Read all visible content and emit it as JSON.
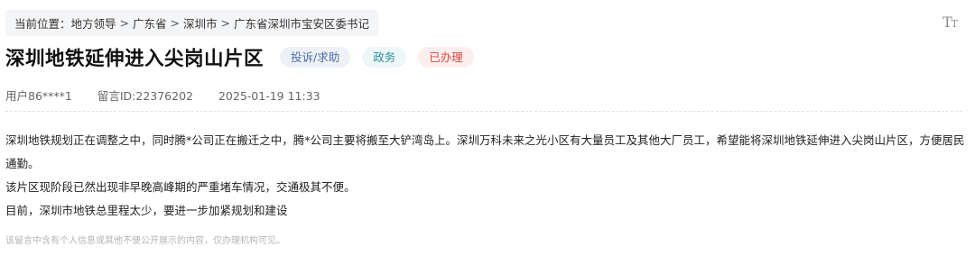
{
  "breadcrumb": {
    "prefix": "当前位置：",
    "items": [
      "地方领导",
      "广东省",
      "深圳市",
      "广东省深圳市宝安区委书记"
    ],
    "separator": ">"
  },
  "font_toggle": {
    "big": "T",
    "small": "T"
  },
  "header": {
    "title": "深圳地铁延伸进入尖岗山片区",
    "tags": {
      "type": "投诉/求助",
      "domain": "政务",
      "status": "已办理"
    }
  },
  "meta": {
    "user": "用户86****1",
    "message_id": "留言ID:22376202",
    "time": "2025-01-19 11:33"
  },
  "content": {
    "paragraphs": [
      "深圳地铁规划正在调整之中，同时腾*公司正在搬迁之中，腾*公司主要将搬至大铲湾岛上。深圳万科未来之光小区有大量员工及其他大厂员工，希望能将深圳地铁延伸进入尖岗山片区，方便居民通勤。",
      "该片区现阶段已然出现非早晚高峰期的严重堵车情况，交通极其不便。",
      "目前，深圳市地铁总里程太少，要进一步加紧规划和建设"
    ]
  },
  "notice": "该留言中含有个人信息或其他不便公开展示的内容，仅办理机构可见。",
  "colors": {
    "tag_type_text": "#4a6ea8",
    "tag_domain_text": "#2d8ea0",
    "tag_status_text": "#d9473f",
    "breadcrumb_bg": "#f4f5f7"
  }
}
